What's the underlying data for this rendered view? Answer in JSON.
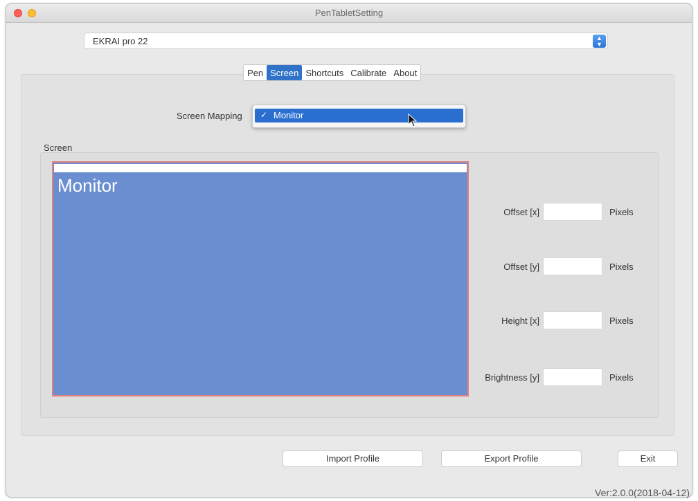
{
  "window": {
    "title": "PenTabletSetting"
  },
  "device_select": {
    "value": "EKRAI pro 22",
    "stepper_icon": "up-down-chevron-icon"
  },
  "tabs": [
    {
      "label": "Pen",
      "active": false
    },
    {
      "label": "Screen",
      "active": true
    },
    {
      "label": "Shortcuts",
      "active": false
    },
    {
      "label": "Calibrate",
      "active": false
    },
    {
      "label": "About",
      "active": false
    }
  ],
  "mapping": {
    "label": "Screen Mapping",
    "selected": "Monitor"
  },
  "screen": {
    "label": "Screen",
    "monitor_label": "Monitor"
  },
  "fields": {
    "offset_x": {
      "label": "Offset [x]",
      "value": "",
      "unit": "Pixels"
    },
    "offset_y": {
      "label": "Offset [y]",
      "value": "",
      "unit": "Pixels"
    },
    "height_x": {
      "label": "Height [x]",
      "value": "",
      "unit": "Pixels"
    },
    "brightness_y": {
      "label": "Brightness [y]",
      "value": "",
      "unit": "Pixels"
    }
  },
  "buttons": {
    "import": "Import Profile",
    "export": "Export Profile",
    "exit": "Exit"
  },
  "version": "Ver:2.0.0(2018-04-12)",
  "colors": {
    "accent": "#2f72c8",
    "monitor_fill": "#6a8ed0",
    "monitor_border": "#e08080"
  }
}
